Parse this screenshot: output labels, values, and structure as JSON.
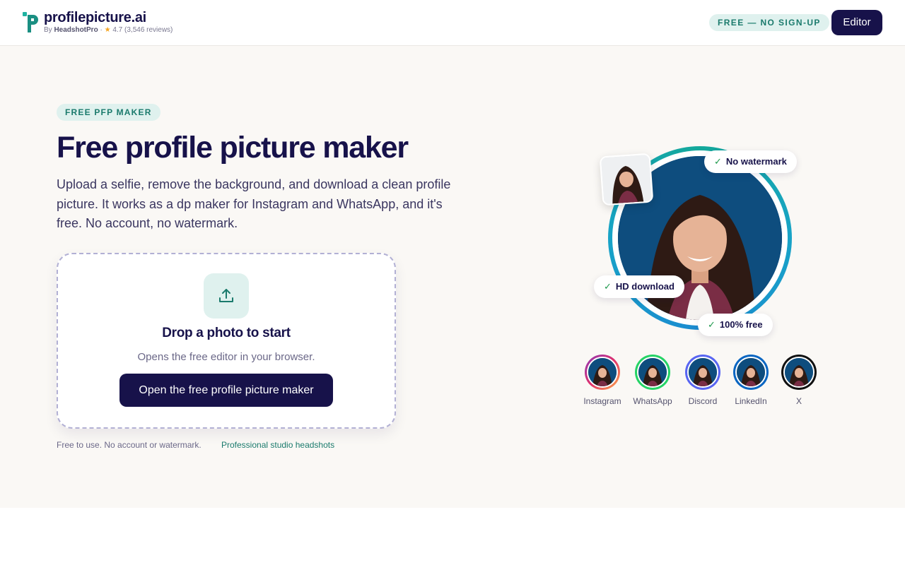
{
  "header": {
    "brand": "profilepicture.ai",
    "byline_prefix": "By",
    "byline_company": "HeadshotPro",
    "byline_sep": "·",
    "star": "★",
    "rating": "4.7 (3,546 reviews)",
    "free_badge": "FREE — NO SIGN-UP",
    "editor_button": "Editor"
  },
  "hero": {
    "badge": "FREE PFP MAKER",
    "title": "Free profile picture maker",
    "lead": "Upload a selfie, remove the background, and download a clean profile picture. It works as a dp maker for Instagram and WhatsApp, and it's free. No account, no watermark.",
    "dropzone": {
      "title": "Drop a photo to start",
      "subtitle": "Opens the free editor in your browser.",
      "button": "Open the free profile picture maker"
    },
    "footnote": "Free to use. No account or watermark.",
    "footlink": "Professional studio headshots"
  },
  "visual": {
    "chips": {
      "no_watermark": "No watermark",
      "hd_download": "HD download",
      "free": "100% free"
    },
    "check_glyph": "✓",
    "platforms": [
      {
        "label": "Instagram",
        "color": "#d6336c"
      },
      {
        "label": "WhatsApp",
        "color": "#25d366"
      },
      {
        "label": "Discord",
        "color": "#5865f2"
      },
      {
        "label": "LinkedIn",
        "color": "#0a66c2"
      },
      {
        "label": "X",
        "color": "#111111"
      }
    ]
  },
  "colors": {
    "navy": "#17124a",
    "teal": "#1a7a6c",
    "teal_bg": "#dff1ee",
    "hero_bg": "#faf8f5"
  }
}
